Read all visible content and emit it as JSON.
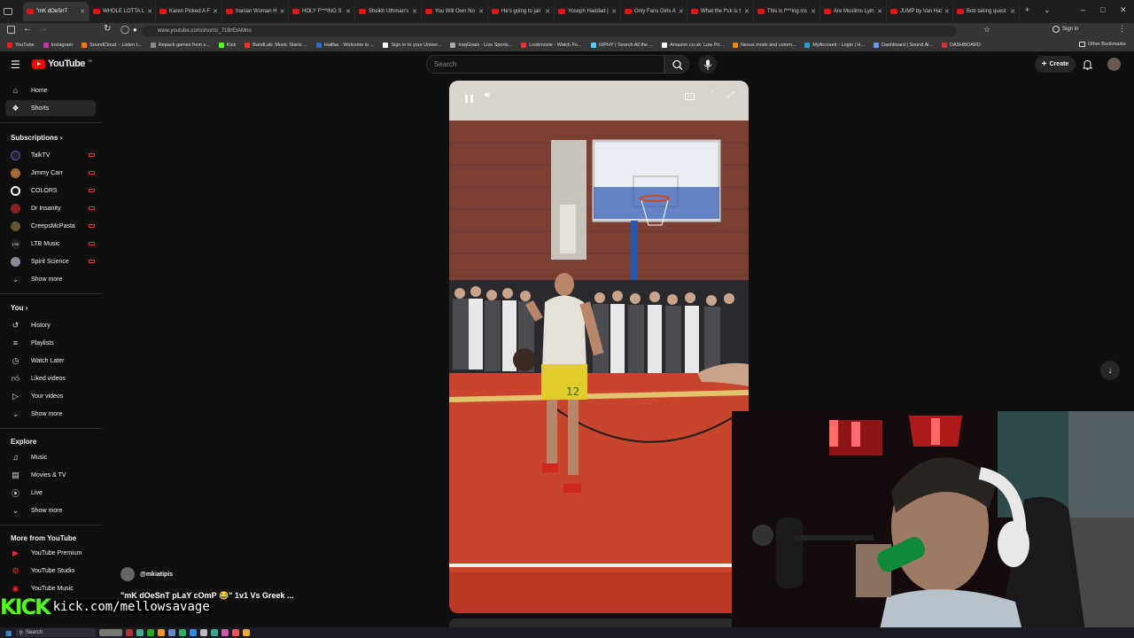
{
  "browser": {
    "tabs": [
      {
        "label": "\"mK dOeSnT",
        "active": true
      },
      {
        "label": "WHOLE LOTTA L"
      },
      {
        "label": "Karen Picked A F"
      },
      {
        "label": "Iranian Woman H"
      },
      {
        "label": "HOLY F***ING S"
      },
      {
        "label": "Sheikh Uthman's"
      },
      {
        "label": "You Will Own No"
      },
      {
        "label": "He's going to jail"
      },
      {
        "label": "Yoseph Haddad |"
      },
      {
        "label": "Only Fans Girls A"
      },
      {
        "label": "What the f*ck is t"
      },
      {
        "label": "This is f***ing ins"
      },
      {
        "label": "Are Muslims Lyin"
      },
      {
        "label": "JUMP by Van Hal"
      },
      {
        "label": "Bob taking quest"
      }
    ],
    "url": "www.youtube.com/shorts/_71BrEtAMno",
    "sign_in": "Sign in",
    "bookmarks": [
      {
        "label": "YouTube",
        "color": "#e22"
      },
      {
        "label": "Instagram",
        "color": "#c3a"
      },
      {
        "label": "SoundCloud – Listen t...",
        "color": "#f70"
      },
      {
        "label": "Repack games from x...",
        "color": "#888"
      },
      {
        "label": "Kick",
        "color": "#53fc18"
      },
      {
        "label": "BandLab: Music Starts ...",
        "color": "#e33"
      },
      {
        "label": "Halifax - Welcome to ...",
        "color": "#36c"
      },
      {
        "label": "Sign in to your Univer...",
        "color": "#fff"
      },
      {
        "label": "IraqGoals - Live Sports...",
        "color": "#aaa"
      },
      {
        "label": "Lookmovie - Watch Fo...",
        "color": "#e33"
      },
      {
        "label": "GIPHY | Search All the ...",
        "color": "#5cf"
      },
      {
        "label": "Amazon.co.uk: Low Pri...",
        "color": "#fff"
      },
      {
        "label": "Nexus mods and comm...",
        "color": "#e80"
      },
      {
        "label": "MyAccount - Login | H...",
        "color": "#39c"
      },
      {
        "label": "Dashboard | Sound Al...",
        "color": "#69f"
      },
      {
        "label": "DASHBOARD",
        "color": "#c33"
      }
    ],
    "other_bookmarks": "Other Bookmarks"
  },
  "header": {
    "logo": "YouTube",
    "logo_region": "GB",
    "search_placeholder": "Search",
    "create": "Create"
  },
  "sidebar": {
    "main": [
      {
        "label": "Home",
        "icon": "home-icon"
      },
      {
        "label": "Shorts",
        "icon": "shorts-icon",
        "active": true
      }
    ],
    "subscriptions_title": "Subscriptions",
    "subscriptions": [
      {
        "label": "TalkTV",
        "color": "#223"
      },
      {
        "label": "Jimmy Carr",
        "color": "#a63"
      },
      {
        "label": "COLORS",
        "color": "#fff"
      },
      {
        "label": "Dr Insanity",
        "color": "#822"
      },
      {
        "label": "CreepsMcPasta",
        "color": "#653"
      },
      {
        "label": "LTB Music",
        "color": "#222"
      },
      {
        "label": "Spirit Science",
        "color": "#889"
      }
    ],
    "show_more": "Show more",
    "you_title": "You",
    "you": [
      {
        "label": "History",
        "icon": "history-icon"
      },
      {
        "label": "Playlists",
        "icon": "playlists-icon"
      },
      {
        "label": "Watch Later",
        "icon": "watch-later-icon"
      },
      {
        "label": "Liked videos",
        "icon": "like-icon"
      },
      {
        "label": "Your videos",
        "icon": "your-videos-icon"
      }
    ],
    "explore_title": "Explore",
    "explore": [
      {
        "label": "Music",
        "icon": "music-icon"
      },
      {
        "label": "Movies & TV",
        "icon": "movies-icon"
      },
      {
        "label": "Live",
        "icon": "live-icon"
      }
    ],
    "more_title": "More from YouTube",
    "more": [
      {
        "label": "YouTube Premium"
      },
      {
        "label": "YouTube Studio"
      },
      {
        "label": "YouTube Music"
      }
    ]
  },
  "short": {
    "creator": "@mkiatipis",
    "title": "\"mK dOeSnT pLaY cOmP 😂\" 1v1 Vs Greek ...",
    "jersey_number": "12"
  },
  "overlay": {
    "kick_logo": "KICK",
    "kick_url": "kick.com/mellowsavage"
  },
  "taskbar": {
    "search": "Search"
  }
}
